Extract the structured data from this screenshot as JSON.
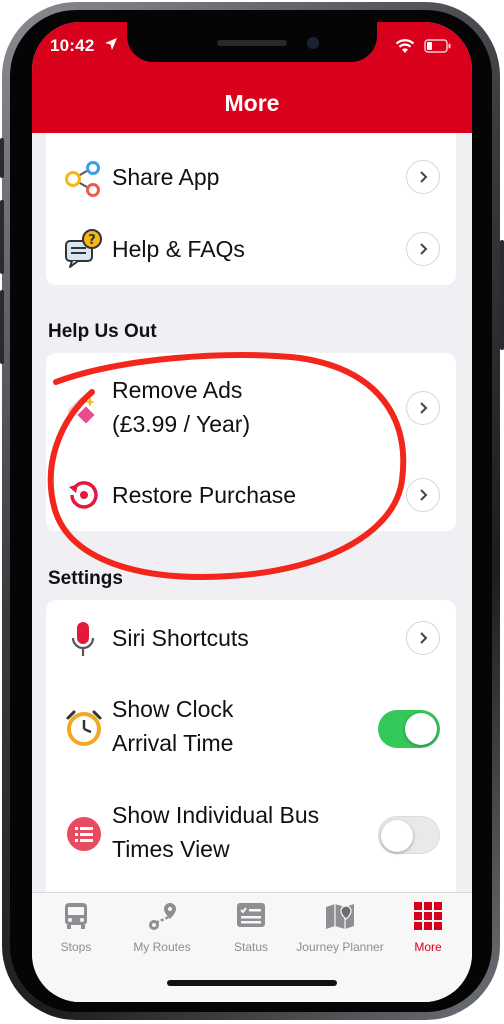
{
  "status_bar": {
    "time": "10:42"
  },
  "header": {
    "title": "More"
  },
  "top_items": [
    {
      "label": "Share App",
      "icon": "share-icon"
    },
    {
      "label": "Help & FAQs",
      "icon": "help-chat-icon"
    }
  ],
  "help_section": {
    "title": "Help Us Out",
    "remove_ads": {
      "line1": "Remove Ads",
      "line2": "(£3.99 / Year)"
    },
    "restore": {
      "label": "Restore Purchase"
    }
  },
  "settings_section": {
    "title": "Settings",
    "siri": {
      "label": "Siri Shortcuts"
    },
    "clock": {
      "line1": "Show Clock",
      "line2": "Arrival Time",
      "enabled": true
    },
    "individual": {
      "line1": "Show Individual Bus",
      "line2": "Times View",
      "enabled": false
    }
  },
  "tabs": [
    {
      "label": "Stops",
      "icon": "bus-icon"
    },
    {
      "label": "My Routes",
      "icon": "routes-icon"
    },
    {
      "label": "Status",
      "icon": "status-icon"
    },
    {
      "label": "Journey Planner",
      "icon": "map-icon"
    },
    {
      "label": "More",
      "icon": "grid-icon",
      "active": true
    }
  ],
  "colors": {
    "brand_red": "#d9001b",
    "toggle_on": "#34c759",
    "annotation_red": "#f2261b"
  }
}
